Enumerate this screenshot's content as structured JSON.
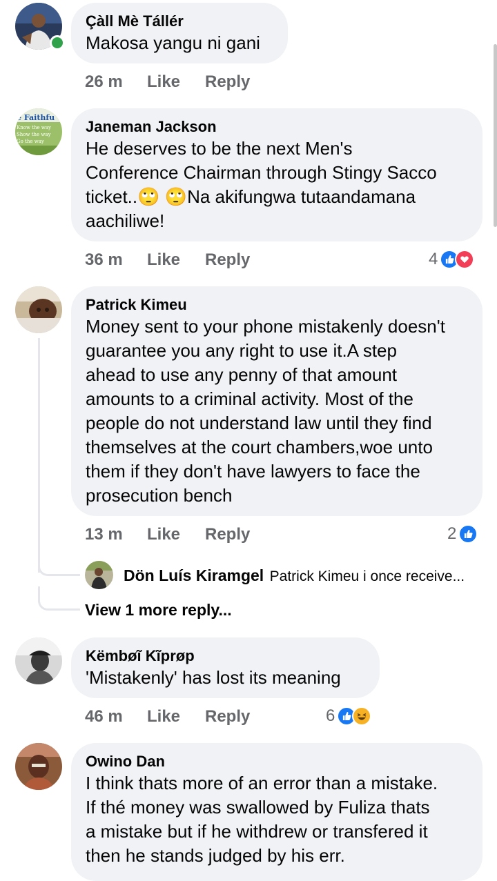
{
  "comments": [
    {
      "name": "Çàll Mè Tállér",
      "lines": [
        "Makosa yangu ni gani"
      ],
      "time": "26 m",
      "like": "Like",
      "reply": "Reply",
      "online": true
    },
    {
      "name": "Janeman Jackson",
      "lines": [
        "He deserves to be the next Men's",
        "Conference Chairman through Stingy Sacco",
        "ticket..🙄 🙄Na akifungwa tutaandamana",
        "aachiliwe!"
      ],
      "time": "36 m",
      "like": "Like",
      "reply": "Reply",
      "reaction_count": "4",
      "reactions": [
        "like-icon",
        "love-icon"
      ],
      "avatar_text": [
        "e Faithfu",
        "Know the way",
        "Show the way",
        "Go the way"
      ]
    },
    {
      "name": "Patrick Kimeu",
      "lines": [
        "Money sent to your phone mistakenly doesn't",
        "guarantee you any right to use it.A step",
        "ahead to use any penny of that amount",
        "amounts to a criminal activity. Most of the",
        "people do not understand law until they find",
        "themselves at the court chambers,woe unto",
        "them if they don't have lawyers to face the",
        "prosecution bench"
      ],
      "time": "13 m",
      "like": "Like",
      "reply": "Reply",
      "reaction_count": "2",
      "reactions": [
        "like-icon"
      ],
      "reply_preview": {
        "name": "Dön Luís Kiramgel",
        "text": "Patrick Kimeu i once receive..."
      },
      "view_more": "View 1 more reply..."
    },
    {
      "name": "Këmbøĩ Kĩprøp",
      "lines": [
        "'Mistakenly' has lost its meaning"
      ],
      "time": "46 m",
      "like": "Like",
      "reply": "Reply",
      "reaction_count": "6",
      "reactions": [
        "like-icon",
        "haha-icon"
      ]
    },
    {
      "name": "Owino Dan",
      "lines": [
        "I think thats more of an error than a mistake.",
        "If thé money was swallowed by Fuliza thats",
        "a mistake but if he withdrew or transfered it",
        "then he stands judged by his err."
      ]
    }
  ],
  "colors": {
    "bubble": "#f0f2f5",
    "meta_text": "#65676b",
    "like_blue": "#1877f2",
    "love_red": "#f33e58",
    "haha_yellow": "#f7b125",
    "online_green": "#31a24c"
  }
}
